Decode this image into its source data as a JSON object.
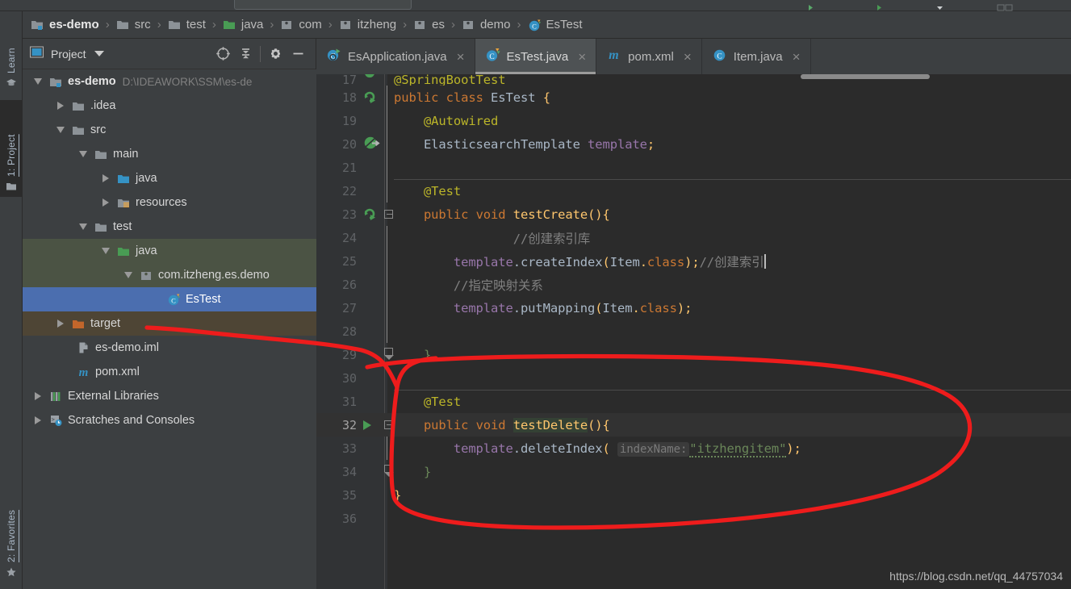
{
  "window": {
    "colors": {
      "accent_selection": "#4b6eaf",
      "editor_bg": "#2b2b2b",
      "panel_bg": "#3c3f41",
      "gutter_bg": "#313335",
      "annotation_red": "#ee1c1c",
      "test_source_root": "#4b5344",
      "excluded_target": "#4e4535"
    }
  },
  "left_tool_tabs": [
    {
      "label": "Learn",
      "icon": "graduation-cap-icon",
      "selected": false
    },
    {
      "label": "1: Project",
      "icon": "folder-icon",
      "selected": true
    },
    {
      "label": "2: Favorites",
      "icon": "star-icon",
      "selected": false
    }
  ],
  "breadcrumb": {
    "items": [
      {
        "label": "es-demo",
        "icon": "module-folder-icon"
      },
      {
        "label": "src",
        "icon": "folder-icon"
      },
      {
        "label": "test",
        "icon": "folder-icon"
      },
      {
        "label": "java",
        "icon": "test-source-folder-icon"
      },
      {
        "label": "com",
        "icon": "package-icon"
      },
      {
        "label": "itzheng",
        "icon": "package-icon"
      },
      {
        "label": "es",
        "icon": "package-icon"
      },
      {
        "label": "demo",
        "icon": "package-icon"
      },
      {
        "label": "EsTest",
        "icon": "java-test-class-icon"
      }
    ],
    "separator": "›"
  },
  "project_panel": {
    "title": "Project",
    "toolbar": [
      {
        "name": "select-opened-file-icon",
        "tooltip": "Select Opened File"
      },
      {
        "name": "collapse-all-icon",
        "tooltip": "Collapse All"
      },
      {
        "name": "gear-icon",
        "tooltip": "Settings"
      },
      {
        "name": "minimize-icon",
        "tooltip": "Hide"
      }
    ],
    "tree": [
      {
        "label": "es-demo",
        "detail": "D:\\IDEAWORK\\SSM\\es-de",
        "indent": 0,
        "twisty": "down",
        "icon": "module-folder-icon",
        "bold": true,
        "state": "normal"
      },
      {
        "label": ".idea",
        "detail": "",
        "indent": 1,
        "twisty": "right",
        "icon": "folder-icon",
        "bold": false,
        "state": "normal"
      },
      {
        "label": "src",
        "detail": "",
        "indent": 1,
        "twisty": "down",
        "icon": "folder-icon",
        "bold": false,
        "state": "normal"
      },
      {
        "label": "main",
        "detail": "",
        "indent": 2,
        "twisty": "down",
        "icon": "folder-icon",
        "bold": false,
        "state": "normal"
      },
      {
        "label": "java",
        "detail": "",
        "indent": 3,
        "twisty": "right",
        "icon": "source-folder-icon",
        "bold": false,
        "state": "normal"
      },
      {
        "label": "resources",
        "detail": "",
        "indent": 3,
        "twisty": "right",
        "icon": "resources-folder-icon",
        "bold": false,
        "state": "normal"
      },
      {
        "label": "test",
        "detail": "",
        "indent": 2,
        "twisty": "down",
        "icon": "folder-icon",
        "bold": false,
        "state": "normal"
      },
      {
        "label": "java",
        "detail": "",
        "indent": 3,
        "twisty": "down",
        "icon": "test-source-folder-icon",
        "bold": false,
        "state": "testroot"
      },
      {
        "label": "com.itzheng.es.demo",
        "detail": "",
        "indent": 4,
        "twisty": "down",
        "icon": "package-icon",
        "bold": false,
        "state": "testroot"
      },
      {
        "label": "EsTest",
        "detail": "",
        "indent": 5,
        "twisty": "none",
        "icon": "java-test-class-icon",
        "bold": false,
        "state": "selected"
      },
      {
        "label": "target",
        "detail": "",
        "indent": 1,
        "twisty": "right",
        "icon": "excluded-folder-icon",
        "bold": false,
        "state": "excluded"
      },
      {
        "label": "es-demo.iml",
        "detail": "",
        "indent": 2,
        "twisty": "none",
        "icon": "iml-file-icon",
        "bold": false,
        "state": "normal"
      },
      {
        "label": "pom.xml",
        "detail": "",
        "indent": 2,
        "twisty": "none",
        "icon": "maven-file-icon",
        "bold": false,
        "state": "normal"
      },
      {
        "label": "External Libraries",
        "detail": "",
        "indent": 0,
        "twisty": "right",
        "icon": "libraries-icon",
        "bold": false,
        "state": "normal"
      },
      {
        "label": "Scratches and Consoles",
        "detail": "",
        "indent": 0,
        "twisty": "right",
        "icon": "scratches-icon",
        "bold": false,
        "state": "normal"
      }
    ]
  },
  "editor_tabs": [
    {
      "label": "EsApplication.java",
      "icon": "spring-boot-class-icon",
      "active": false,
      "close": "×"
    },
    {
      "label": "EsTest.java",
      "icon": "java-test-class-icon",
      "active": true,
      "close": "×"
    },
    {
      "label": "pom.xml",
      "icon": "maven-file-icon",
      "active": false,
      "close": "×"
    },
    {
      "label": "Item.java",
      "icon": "java-class-icon",
      "active": false,
      "close": "×"
    }
  ],
  "editor": {
    "first_visible_line": 17,
    "current_line": 32,
    "lines": [
      {
        "n": 17,
        "gutter": "run-test-icon-clipped",
        "fold": "start-clipped"
      },
      {
        "n": 18,
        "gutter": "override-icon",
        "fold": "line"
      },
      {
        "n": 19,
        "gutter": "",
        "fold": "line"
      },
      {
        "n": 20,
        "gutter": "bean-icon",
        "fold": "line"
      },
      {
        "n": 21,
        "gutter": "",
        "fold": "line"
      },
      {
        "n": 22,
        "gutter": "",
        "fold": "line"
      },
      {
        "n": 23,
        "gutter": "run-test-icon",
        "fold": "start"
      },
      {
        "n": 24,
        "gutter": "",
        "fold": "line"
      },
      {
        "n": 25,
        "gutter": "",
        "fold": "line"
      },
      {
        "n": 26,
        "gutter": "",
        "fold": "line"
      },
      {
        "n": 27,
        "gutter": "",
        "fold": "line"
      },
      {
        "n": 28,
        "gutter": "",
        "fold": "line"
      },
      {
        "n": 29,
        "gutter": "",
        "fold": "end"
      },
      {
        "n": 30,
        "gutter": "",
        "fold": ""
      },
      {
        "n": 31,
        "gutter": "",
        "fold": ""
      },
      {
        "n": 32,
        "gutter": "run-green-triangle",
        "fold": "start"
      },
      {
        "n": 33,
        "gutter": "",
        "fold": "line"
      },
      {
        "n": 34,
        "gutter": "",
        "fold": "end"
      },
      {
        "n": 35,
        "gutter": "",
        "fold": ""
      },
      {
        "n": 36,
        "gutter": "",
        "fold": ""
      }
    ],
    "code_text": {
      "l17": "@SpringBootTest",
      "l18": "public class EsTest {",
      "l19": "    @Autowired",
      "l20": "    ElasticsearchTemplate template;",
      "l21": "",
      "l22": "    @Test",
      "l23": "    public void testCreate(){",
      "l24": "        //创建索引库",
      "l25": "        template.createIndex(Item.class);//创建索引",
      "l26": "        //指定映射关系",
      "l27": "        template.putMapping(Item.class);",
      "l28": "",
      "l29": "    }",
      "l30": "",
      "l31": "    @Test",
      "l32": "    public void testDelete(){",
      "l33": "        template.deleteIndex( indexName: \"itzhengitem\");",
      "l34": "    }",
      "l35": "}",
      "l36": ""
    },
    "tokens": {
      "annotation_springboottest": "@SpringBootTest",
      "kw_public": "public",
      "kw_class": "class",
      "kw_void": "void",
      "type_estest": "EsTest",
      "annotation_autowired": "@Autowired",
      "type_elasticsearchtemplate": "ElasticsearchTemplate",
      "field_template": "template",
      "annotation_test": "@Test",
      "method_testcreate": "testCreate",
      "method_testdelete": "testDelete",
      "comment_create_index_lib": "//创建索引库",
      "comment_create_index": "//创建索引",
      "comment_mapping": "//指定映射关系",
      "call_createindex": "createIndex",
      "call_putmapping": "putMapping",
      "call_deleteindex": "deleteIndex",
      "arg_item_class": "Item.class",
      "param_hint_indexname": "indexName:",
      "string_itzhengitem": "\"itzhengitem\""
    }
  },
  "annotation": {
    "type": "hand-drawn-red-loop",
    "color": "#ee1c1c",
    "description": "red freehand oval circling the testDelete method, with a tail pointing to EsTest in the project tree"
  },
  "watermark": {
    "text": "https://blog.csdn.net/qq_44757034"
  }
}
